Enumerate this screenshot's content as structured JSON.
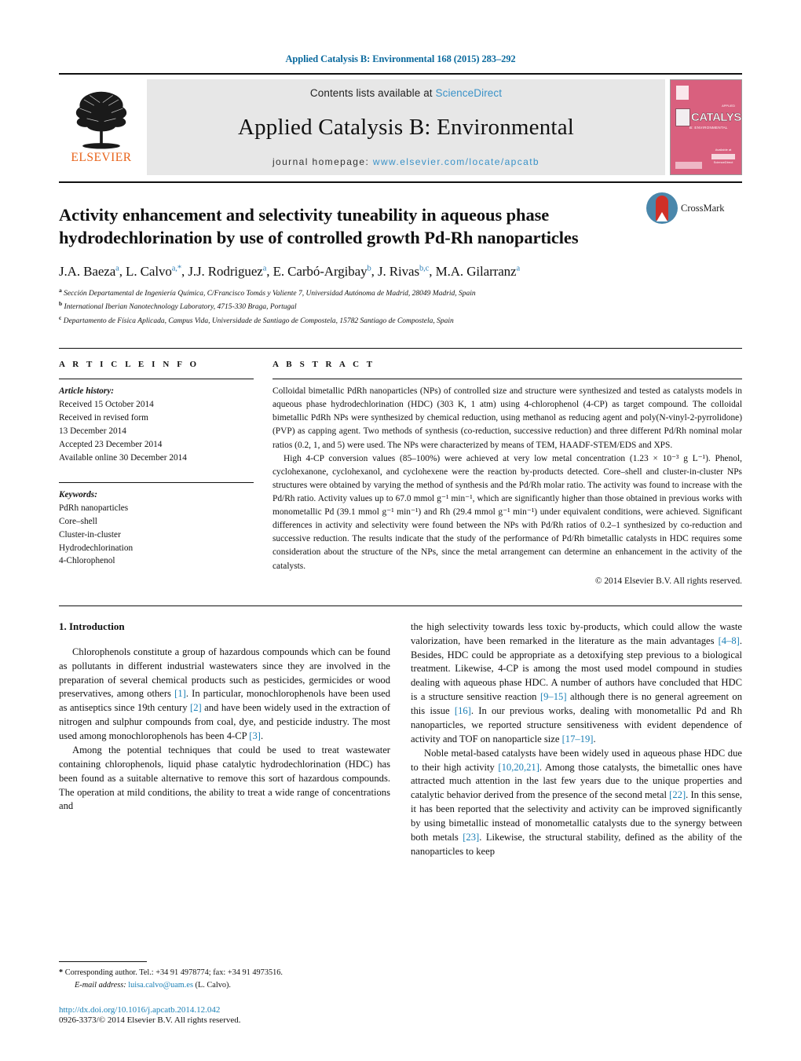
{
  "running_head": "Applied Catalysis B: Environmental 168 (2015) 283–292",
  "masthead": {
    "contents_prefix": "Contents lists available at ",
    "contents_link": "ScienceDirect",
    "journal_title": "Applied Catalysis B: Environmental",
    "homepage_prefix": "journal homepage: ",
    "homepage_url": "www.elsevier.com/locate/apcatb",
    "publisher_wordmark": "ELSEVIER",
    "cover": {
      "word": "CATALYSIS",
      "superscript": "APPLIED",
      "subtitle": "B: ENVIRONMENTAL",
      "footer_top": "Available at",
      "footer_bottom": "ScienceDirect"
    }
  },
  "article": {
    "title": "Activity enhancement and selectivity tuneability in aqueous phase hydrodechlorination by use of controlled growth Pd-Rh nanoparticles",
    "crossmark_label": "CrossMark",
    "authors": [
      {
        "name": "J.A. Baeza",
        "sup": "a",
        "sep": ", "
      },
      {
        "name": "L. Calvo",
        "sup": "a,*",
        "sep": ", "
      },
      {
        "name": "J.J. Rodriguez",
        "sup": "a",
        "sep": ", "
      },
      {
        "name": "E. Carbó-Argibay",
        "sup": "b",
        "sep": ", "
      },
      {
        "name": "J. Rivas",
        "sup": "b,c",
        "sep": ", "
      },
      {
        "name": "M.A. Gilarranz",
        "sup": "a",
        "sep": ""
      }
    ],
    "affiliations": [
      {
        "mark": "a",
        "text": "Sección Departamental de Ingeniería Química, C/Francisco Tomás y Valiente 7, Universidad Autónoma de Madrid, 28049 Madrid, Spain"
      },
      {
        "mark": "b",
        "text": "International Iberian Nanotechnology Laboratory, 4715-330 Braga, Portugal"
      },
      {
        "mark": "c",
        "text": "Departamento de Física Aplicada, Campus Vida, Universidade de Santiago de Compostela, 15782 Santiago de Compostela, Spain"
      }
    ]
  },
  "article_info": {
    "heading": "A R T I C L E    I N F O",
    "history_label": "Article history:",
    "history": [
      "Received 15 October 2014",
      "Received in revised form",
      "13 December 2014",
      "Accepted 23 December 2014",
      "Available online 30 December 2014"
    ],
    "keywords_label": "Keywords:",
    "keywords": [
      "PdRh nanoparticles",
      "Core–shell",
      "Cluster-in-cluster",
      "Hydrodechlorination",
      "4-Chlorophenol"
    ]
  },
  "abstract": {
    "heading": "A B S T R A C T",
    "paragraph_1": "Colloidal bimetallic PdRh nanoparticles (NPs) of controlled size and structure were synthesized and tested as catalysts models in aqueous phase hydrodechlorination (HDC) (303 K, 1 atm) using 4-chlorophenol (4-CP) as target compound. The colloidal bimetallic PdRh NPs were synthesized by chemical reduction, using methanol as reducing agent and poly(N-vinyl-2-pyrrolidone) (PVP) as capping agent. Two methods of synthesis (co-reduction, successive reduction) and three different Pd/Rh nominal molar ratios (0.2, 1, and 5) were used. The NPs were characterized by means of TEM, HAADF-STEM/EDS and XPS.",
    "paragraph_2": "High 4-CP conversion values (85–100%) were achieved at very low metal concentration (1.23 × 10⁻³ g L⁻¹). Phenol, cyclohexanone, cyclohexanol, and cyclohexene were the reaction by-products detected. Core–shell and cluster-in-cluster NPs structures were obtained by varying the method of synthesis and the Pd/Rh molar ratio. The activity was found to increase with the Pd/Rh ratio. Activity values up to 67.0 mmol g⁻¹ min⁻¹, which are significantly higher than those obtained in previous works with monometallic Pd (39.1 mmol g⁻¹ min⁻¹) and Rh (29.4 mmol g⁻¹ min⁻¹) under equivalent conditions, were achieved. Significant differences in activity and selectivity were found between the NPs with Pd/Rh ratios of 0.2–1 synthesized by co-reduction and successive reduction. The results indicate that the study of the performance of Pd/Rh bimetallic catalysts in HDC requires some consideration about the structure of the NPs, since the metal arrangement can determine an enhancement in the activity of the catalysts.",
    "copyright": "© 2014 Elsevier B.V. All rights reserved."
  },
  "introduction": {
    "number_title": "1.  Introduction",
    "left_paragraph_1_a": "Chlorophenols constitute a group of hazardous compounds which can be found as pollutants in different industrial wastewaters since they are involved in the preparation of several chemical products such as pesticides, germicides or wood preservatives, among others ",
    "left_ref_1": "[1]",
    "left_paragraph_1_b": ". In particular, monochlorophenols have been used as antiseptics since 19th century ",
    "left_ref_2": "[2]",
    "left_paragraph_1_c": " and have been widely used in the extraction of nitrogen and sulphur compounds from coal, dye, and pesticide industry. The most used among monochlorophenols has been 4-CP ",
    "left_ref_3": "[3]",
    "left_paragraph_1_d": ".",
    "left_paragraph_2": "Among the potential techniques that could be used to treat wastewater containing chlorophenols, liquid phase catalytic hydrodechlorination (HDC) has been found as a suitable alternative to remove this sort of hazardous compounds. The operation at mild conditions, the ability to treat a wide range of concentrations and",
    "right_paragraph_1_a": "the high selectivity towards less toxic by-products, which could allow the waste valorization, have been remarked in the literature as the main advantages ",
    "right_ref_1": "[4–8]",
    "right_paragraph_1_b": ". Besides, HDC could be appropriate as a detoxifying step previous to a biological treatment. Likewise, 4-CP is among the most used model compound in studies dealing with aqueous phase HDC. A number of authors have concluded that HDC is a structure sensitive reaction ",
    "right_ref_2": "[9–15]",
    "right_paragraph_1_c": " although there is no general agreement on this issue ",
    "right_ref_3": "[16]",
    "right_paragraph_1_d": ". In our previous works, dealing with monometallic Pd and Rh nanoparticles, we reported structure sensitiveness with evident dependence of activity and TOF on nanoparticle size ",
    "right_ref_4": "[17–19]",
    "right_paragraph_1_e": ".",
    "right_paragraph_2_a": "Noble metal-based catalysts have been widely used in aqueous phase HDC due to their high activity ",
    "right_ref_5": "[10,20,21]",
    "right_paragraph_2_b": ". Among those catalysts, the bimetallic ones have attracted much attention in the last few years due to the unique properties and catalytic behavior derived from the presence of the second metal ",
    "right_ref_6": "[22]",
    "right_paragraph_2_c": ". In this sense, it has been reported that the selectivity and activity can be improved significantly by using bimetallic instead of monometallic catalysts due to the synergy between both metals ",
    "right_ref_7": "[23]",
    "right_paragraph_2_d": ". Likewise, the structural stability, defined as the ability of the nanoparticles to keep"
  },
  "footnotes": {
    "star": "*",
    "corresponding_text": " Corresponding author. Tel.: +34 91 4978774; fax: +34 91 4973516.",
    "email_label": "E-mail address:",
    "email": "luisa.calvo@uam.es",
    "email_suffix": " (L. Calvo).",
    "doi": "http://dx.doi.org/10.1016/j.apcatb.2014.12.042",
    "issn": "0926-3373/© 2014 Elsevier B.V. All rights reserved."
  }
}
